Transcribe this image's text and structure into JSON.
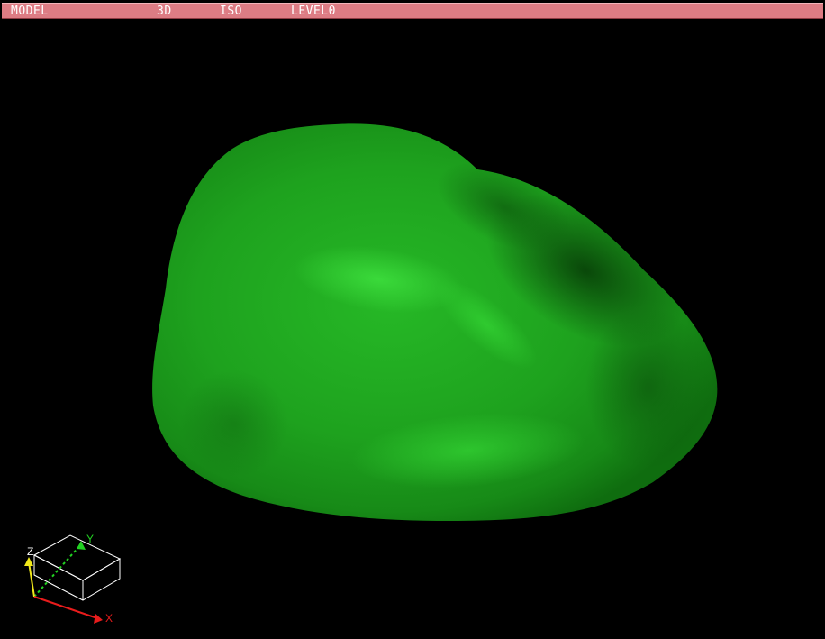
{
  "status_bar": {
    "mode": "MODEL",
    "dimension": "3D",
    "view": "ISO",
    "level": "LEVEL0"
  },
  "axes": {
    "x_label": "X",
    "y_label": "Y",
    "z_label": "Z"
  },
  "colors": {
    "status_bar_bg": "#dd7c84",
    "status_text": "#ffffff",
    "viewport_bg": "#000000",
    "model_color": "#1fa81f",
    "x_axis_color": "#e81c1c",
    "y_axis_color": "#22d122",
    "z_axis_color": "#f0e81a"
  },
  "model": {
    "shape": "shaded-blob-isosurface",
    "icon": "3d-solid-model"
  }
}
